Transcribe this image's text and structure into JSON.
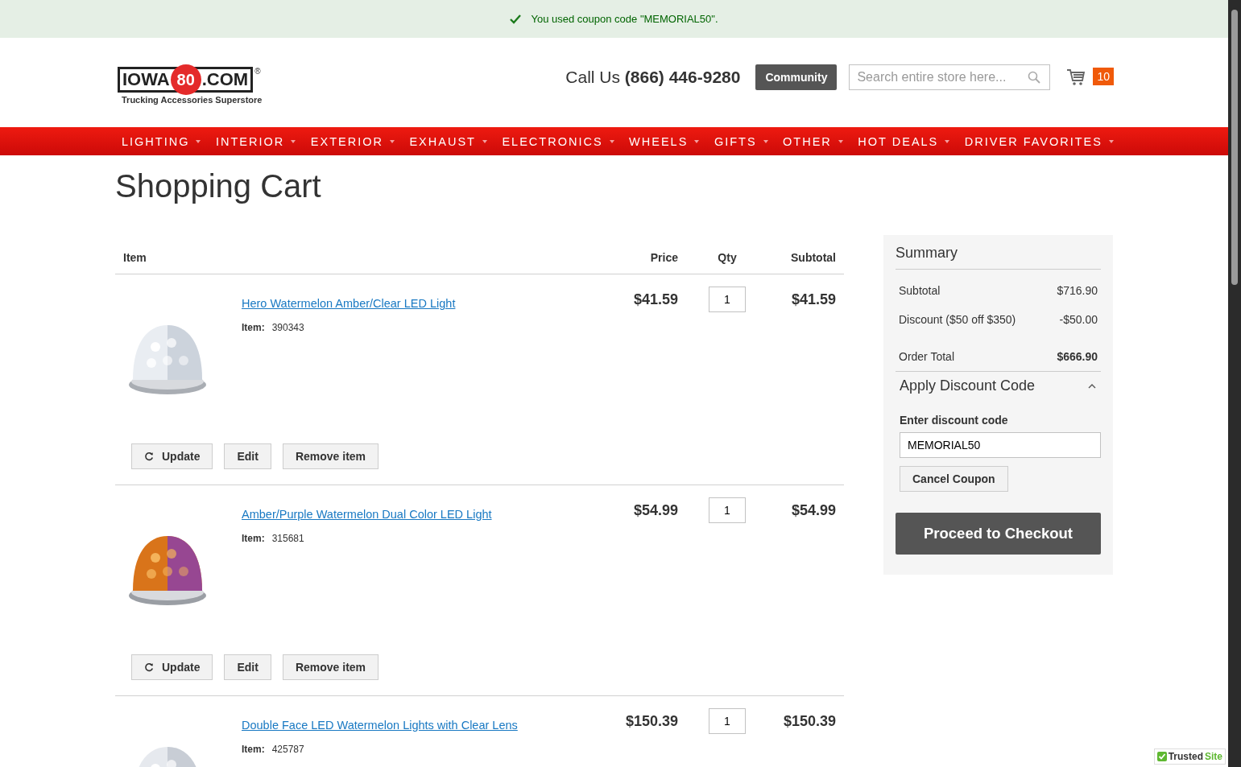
{
  "notice": {
    "message": "You used coupon code \"MEMORIAL50\"."
  },
  "logo": {
    "word": "IOWA",
    "number": "80",
    "domain": ".COM",
    "mark": "®",
    "tagline": "Trucking Accessories Superstore"
  },
  "phone": {
    "label": "Call Us",
    "number": "(866) 446-9280"
  },
  "community_button": "Community",
  "search": {
    "placeholder": "Search entire store here..."
  },
  "cart": {
    "count": "10"
  },
  "nav": [
    "LIGHTING",
    "INTERIOR",
    "EXTERIOR",
    "EXHAUST",
    "ELECTRONICS",
    "WHEELS",
    "GIFTS",
    "OTHER",
    "HOT DEALS",
    "DRIVER FAVORITES"
  ],
  "page_title": "Shopping Cart",
  "table": {
    "columns": [
      "Item",
      "Price",
      "Qty",
      "Subtotal"
    ],
    "rows": [
      {
        "name": "Hero Watermelon Amber/Clear LED Light",
        "item_label": "Item:",
        "item_no": "390343",
        "price": "$41.59",
        "qty": "1",
        "subtotal": "$41.59",
        "picture": {
          "kind": "picture"
        },
        "actions": [
          {
            "label": "Update",
            "kind": "update"
          },
          {
            "label": "Edit",
            "kind": "plain"
          },
          {
            "label": "Remove item",
            "kind": "plain"
          }
        ]
      },
      {
        "name": "Amber/Purple Watermelon Dual Color LED Light",
        "item_label": "Item:",
        "item_no": "315681",
        "price": "$54.99",
        "qty": "1",
        "subtotal": "$54.99",
        "picture": {
          "kind": "picture"
        },
        "actions": [
          {
            "label": "Update",
            "kind": "update"
          },
          {
            "label": "Edit",
            "kind": "plain"
          },
          {
            "label": "Remove item",
            "kind": "plain"
          }
        ]
      },
      {
        "name": "Double Face LED Watermelon Lights with Clear Lens",
        "item_label": "Item:",
        "item_no": "425787",
        "price": "$150.39",
        "qty": "1",
        "subtotal": "$150.39",
        "picture": {
          "kind": "picture"
        }
      }
    ]
  },
  "summary": {
    "title": "Summary",
    "lines": [
      {
        "label": "Subtotal",
        "value": "$716.90",
        "kind": "line"
      },
      {
        "label": "Discount ($50 off $350)",
        "value": "-$50.00",
        "kind": "line"
      },
      {
        "label": "Order Total",
        "value": "$666.90",
        "kind": "total"
      }
    ],
    "discount": {
      "title": "Apply Discount Code",
      "expanded": true,
      "field_label": "Enter discount code",
      "value": "MEMORIAL50",
      "button": "Cancel Coupon"
    },
    "checkout_button": "Proceed to Checkout"
  },
  "trusted_badge": {
    "label": "Trusted",
    "accent": "Site"
  }
}
